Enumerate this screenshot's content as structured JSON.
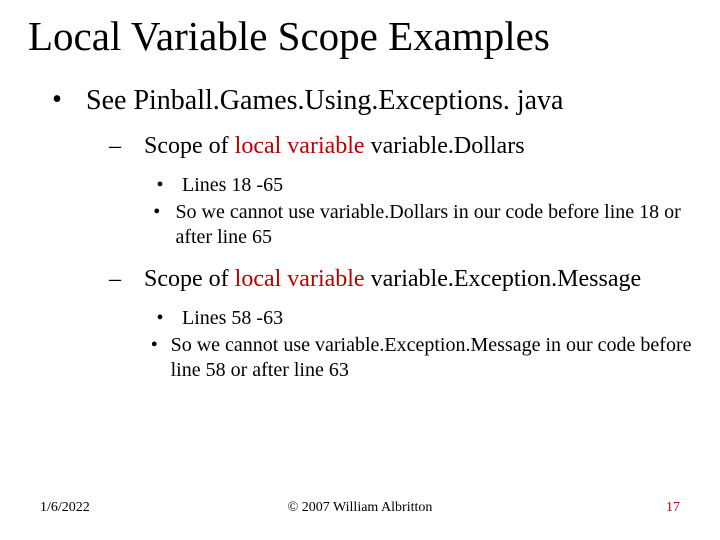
{
  "title": "Local Variable Scope Examples",
  "main_bullet": {
    "prefix": "See ",
    "code": "Pinball.Games.Using.Exceptions. java"
  },
  "sections": [
    {
      "label_prefix": "Scope of ",
      "label_red": "local variable",
      "label_code": " variable.Dollars",
      "lines_label": "Lines 18 -65",
      "note": "So we cannot use variable.Dollars in our code before line 18 or after line 65"
    },
    {
      "label_prefix": "Scope of ",
      "label_red": "local variable",
      "label_code": " variable.Exception.Message",
      "lines_label": "Lines 58 -63",
      "note": "So we cannot use variable.Exception.Message in our code before line 58 or after line 63"
    }
  ],
  "footer": {
    "date": "1/6/2022",
    "copyright": "© 2007 William Albritton",
    "page": "17"
  }
}
